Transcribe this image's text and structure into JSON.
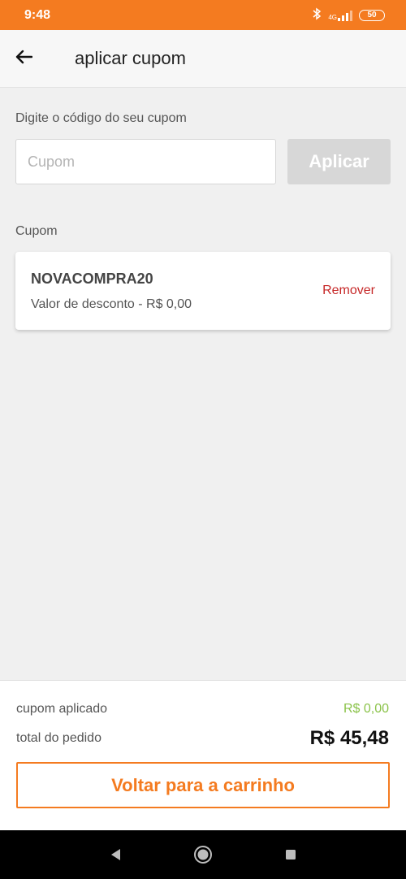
{
  "status_bar": {
    "time": "9:48",
    "battery": "50",
    "network": "4G"
  },
  "header": {
    "title": "aplicar cupom"
  },
  "coupon_entry": {
    "prompt": "Digite o código do seu cupom",
    "input_value": "",
    "input_placeholder": "Cupom",
    "apply_label": "Aplicar"
  },
  "coupon_section": {
    "label": "Cupom",
    "code": "NOVACOMPRA20",
    "discount_text": "Valor de desconto - R$ 0,00",
    "remove_label": "Remover"
  },
  "summary": {
    "applied_label": "cupom aplicado",
    "applied_value": "R$ 0,00",
    "total_label": "total do pedido",
    "total_value": "R$ 45,48",
    "back_button_label": "Voltar para a carrinho"
  },
  "colors": {
    "accent": "#f47b20",
    "remove": "#c62828",
    "applied_value": "#8bc34a"
  },
  "icons": {
    "back": "arrow-left-icon",
    "bluetooth": "bluetooth-icon",
    "signal": "signal-icon",
    "battery": "battery-icon",
    "nav_back": "triangle-back-icon",
    "nav_home": "circle-home-icon",
    "nav_recents": "square-recents-icon"
  }
}
